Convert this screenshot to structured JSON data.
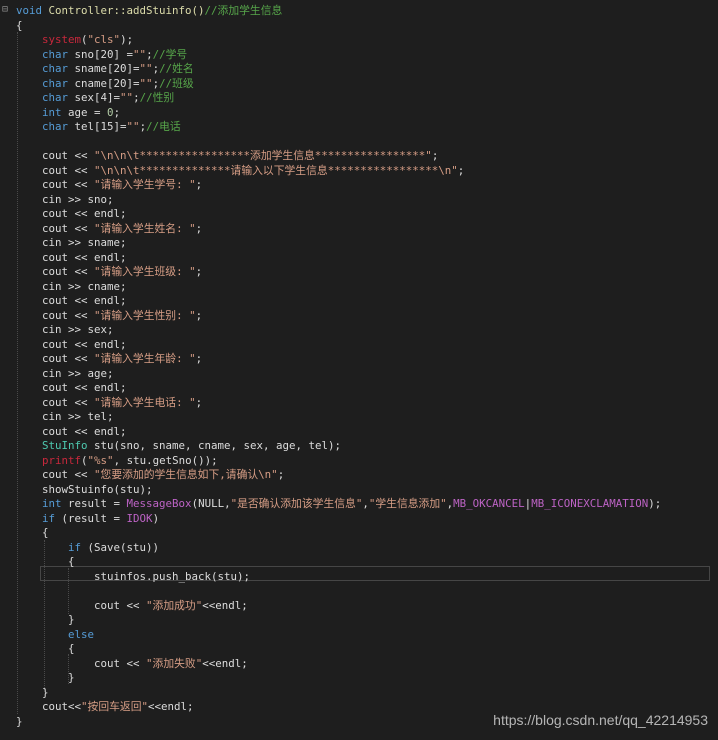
{
  "editor": {
    "lines": [
      [
        {
          "t": "void",
          "c": "kw"
        },
        {
          "t": " Controller::addStuinfo()",
          "c": "fn"
        },
        {
          "t": "//添加学生信息",
          "c": "cm"
        }
      ],
      [
        {
          "t": "{",
          "c": "pl"
        }
      ],
      [
        {
          "t": "    ",
          "c": "pl"
        },
        {
          "t": "system",
          "c": "red"
        },
        {
          "t": "(",
          "c": "pl"
        },
        {
          "t": "\"cls\"",
          "c": "str"
        },
        {
          "t": ");",
          "c": "pl"
        }
      ],
      [
        {
          "t": "    ",
          "c": "pl"
        },
        {
          "t": "char",
          "c": "kw"
        },
        {
          "t": " sno[20] =",
          "c": "pl"
        },
        {
          "t": "\"\"",
          "c": "str"
        },
        {
          "t": ";",
          "c": "pl"
        },
        {
          "t": "//学号",
          "c": "cm"
        }
      ],
      [
        {
          "t": "    ",
          "c": "pl"
        },
        {
          "t": "char",
          "c": "kw"
        },
        {
          "t": " sname[20]=",
          "c": "pl"
        },
        {
          "t": "\"\"",
          "c": "str"
        },
        {
          "t": ";",
          "c": "pl"
        },
        {
          "t": "//姓名",
          "c": "cm"
        }
      ],
      [
        {
          "t": "    ",
          "c": "pl"
        },
        {
          "t": "char",
          "c": "kw"
        },
        {
          "t": " cname[20]=",
          "c": "pl"
        },
        {
          "t": "\"\"",
          "c": "str"
        },
        {
          "t": ";",
          "c": "pl"
        },
        {
          "t": "//班级",
          "c": "cm"
        }
      ],
      [
        {
          "t": "    ",
          "c": "pl"
        },
        {
          "t": "char",
          "c": "kw"
        },
        {
          "t": " sex[4]=",
          "c": "pl"
        },
        {
          "t": "\"\"",
          "c": "str"
        },
        {
          "t": ";",
          "c": "pl"
        },
        {
          "t": "//性别",
          "c": "cm"
        }
      ],
      [
        {
          "t": "    ",
          "c": "pl"
        },
        {
          "t": "int",
          "c": "kw"
        },
        {
          "t": " age = ",
          "c": "pl"
        },
        {
          "t": "0",
          "c": "num"
        },
        {
          "t": ";",
          "c": "pl"
        }
      ],
      [
        {
          "t": "    ",
          "c": "pl"
        },
        {
          "t": "char",
          "c": "kw"
        },
        {
          "t": " tel[15]=",
          "c": "pl"
        },
        {
          "t": "\"\"",
          "c": "str"
        },
        {
          "t": ";",
          "c": "pl"
        },
        {
          "t": "//电话",
          "c": "cm"
        }
      ],
      [],
      [
        {
          "t": "    cout << ",
          "c": "pl"
        },
        {
          "t": "\"\\n\\n\\t*****************添加学生信息*****************\"",
          "c": "str"
        },
        {
          "t": ";",
          "c": "pl"
        }
      ],
      [
        {
          "t": "    cout << ",
          "c": "pl"
        },
        {
          "t": "\"\\n\\n\\t**************请输入以下学生信息*****************\\n\"",
          "c": "str"
        },
        {
          "t": ";",
          "c": "pl"
        }
      ],
      [
        {
          "t": "    cout << ",
          "c": "pl"
        },
        {
          "t": "\"请输入学生学号: \"",
          "c": "str"
        },
        {
          "t": ";",
          "c": "pl"
        }
      ],
      [
        {
          "t": "    cin >> sno;",
          "c": "pl"
        }
      ],
      [
        {
          "t": "    cout << endl;",
          "c": "pl"
        }
      ],
      [
        {
          "t": "    cout << ",
          "c": "pl"
        },
        {
          "t": "\"请输入学生姓名: \"",
          "c": "str"
        },
        {
          "t": ";",
          "c": "pl"
        }
      ],
      [
        {
          "t": "    cin >> sname;",
          "c": "pl"
        }
      ],
      [
        {
          "t": "    cout << endl;",
          "c": "pl"
        }
      ],
      [
        {
          "t": "    cout << ",
          "c": "pl"
        },
        {
          "t": "\"请输入学生班级: \"",
          "c": "str"
        },
        {
          "t": ";",
          "c": "pl"
        }
      ],
      [
        {
          "t": "    cin >> cname;",
          "c": "pl"
        }
      ],
      [
        {
          "t": "    cout << endl;",
          "c": "pl"
        }
      ],
      [
        {
          "t": "    cout << ",
          "c": "pl"
        },
        {
          "t": "\"请输入学生性别: \"",
          "c": "str"
        },
        {
          "t": ";",
          "c": "pl"
        }
      ],
      [
        {
          "t": "    cin >> sex;",
          "c": "pl"
        }
      ],
      [
        {
          "t": "    cout << endl;",
          "c": "pl"
        }
      ],
      [
        {
          "t": "    cout << ",
          "c": "pl"
        },
        {
          "t": "\"请输入学生年龄: \"",
          "c": "str"
        },
        {
          "t": ";",
          "c": "pl"
        }
      ],
      [
        {
          "t": "    cin >> age;",
          "c": "pl"
        }
      ],
      [
        {
          "t": "    cout << endl;",
          "c": "pl"
        }
      ],
      [
        {
          "t": "    cout << ",
          "c": "pl"
        },
        {
          "t": "\"请输入学生电话: \"",
          "c": "str"
        },
        {
          "t": ";",
          "c": "pl"
        }
      ],
      [
        {
          "t": "    cin >> tel;",
          "c": "pl"
        }
      ],
      [
        {
          "t": "    cout << endl;",
          "c": "pl"
        }
      ],
      [
        {
          "t": "    ",
          "c": "pl"
        },
        {
          "t": "StuInfo",
          "c": "ty"
        },
        {
          "t": " stu(sno, sname, cname, sex, age, tel);",
          "c": "pl"
        }
      ],
      [
        {
          "t": "    ",
          "c": "pl"
        },
        {
          "t": "printf",
          "c": "red"
        },
        {
          "t": "(",
          "c": "pl"
        },
        {
          "t": "\"%s\"",
          "c": "str"
        },
        {
          "t": ", stu.getSno());",
          "c": "pl"
        }
      ],
      [
        {
          "t": "    cout << ",
          "c": "pl"
        },
        {
          "t": "\"您要添加的学生信息如下,请确认\\n\"",
          "c": "str"
        },
        {
          "t": ";",
          "c": "pl"
        }
      ],
      [
        {
          "t": "    showStuinfo(stu);",
          "c": "pl"
        }
      ],
      [
        {
          "t": "    ",
          "c": "pl"
        },
        {
          "t": "int",
          "c": "kw"
        },
        {
          "t": " result = ",
          "c": "pl"
        },
        {
          "t": "MessageBox",
          "c": "mac"
        },
        {
          "t": "(NULL,",
          "c": "pl"
        },
        {
          "t": "\"是否确认添加该学生信息\"",
          "c": "str"
        },
        {
          "t": ",",
          "c": "pl"
        },
        {
          "t": "\"学生信息添加\"",
          "c": "str"
        },
        {
          "t": ",",
          "c": "pl"
        },
        {
          "t": "MB_OKCANCEL",
          "c": "mac"
        },
        {
          "t": "|",
          "c": "pl"
        },
        {
          "t": "MB_ICONEXCLAMATION",
          "c": "mac"
        },
        {
          "t": ");",
          "c": "pl"
        }
      ],
      [
        {
          "t": "    ",
          "c": "pl"
        },
        {
          "t": "if",
          "c": "kw"
        },
        {
          "t": " (result = ",
          "c": "pl"
        },
        {
          "t": "IDOK",
          "c": "mac"
        },
        {
          "t": ")",
          "c": "pl"
        }
      ],
      [
        {
          "t": "    {",
          "c": "pl"
        }
      ],
      [
        {
          "t": "        ",
          "c": "pl"
        },
        {
          "t": "if",
          "c": "kw"
        },
        {
          "t": " (Save(stu))",
          "c": "pl"
        }
      ],
      [
        {
          "t": "        {",
          "c": "pl"
        }
      ],
      [
        {
          "t": "            stuinfos.push_back(stu);",
          "c": "pl"
        }
      ],
      [],
      [
        {
          "t": "            cout << ",
          "c": "pl"
        },
        {
          "t": "\"添加成功\"",
          "c": "str"
        },
        {
          "t": "<<endl;",
          "c": "pl"
        }
      ],
      [
        {
          "t": "        }",
          "c": "pl"
        }
      ],
      [
        {
          "t": "        ",
          "c": "pl"
        },
        {
          "t": "else",
          "c": "kw"
        }
      ],
      [
        {
          "t": "        {",
          "c": "pl"
        }
      ],
      [
        {
          "t": "            cout << ",
          "c": "pl"
        },
        {
          "t": "\"添加失败\"",
          "c": "str"
        },
        {
          "t": "<<endl;",
          "c": "pl"
        }
      ],
      [
        {
          "t": "        }",
          "c": "pl"
        }
      ],
      [
        {
          "t": "    }",
          "c": "pl"
        }
      ],
      [
        {
          "t": "    cout<<",
          "c": "pl"
        },
        {
          "t": "\"按回车返回\"",
          "c": "str"
        },
        {
          "t": "<<endl;",
          "c": "pl"
        }
      ],
      [
        {
          "t": "}",
          "c": "pl"
        }
      ]
    ]
  },
  "fold_marker": "⊟",
  "watermark": "https://blog.csdn.net/qq_42214953"
}
